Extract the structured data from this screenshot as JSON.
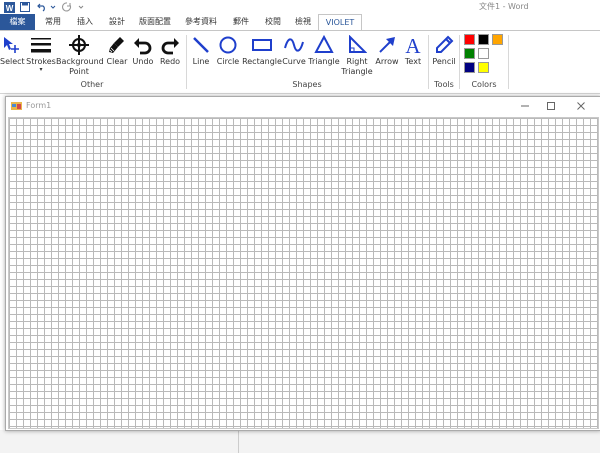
{
  "app": {
    "title": "文件1 - Word"
  },
  "tabs": [
    {
      "label": "檔案"
    },
    {
      "label": "常用"
    },
    {
      "label": "插入"
    },
    {
      "label": "設計"
    },
    {
      "label": "版面配置"
    },
    {
      "label": "參考資料"
    },
    {
      "label": "郵件"
    },
    {
      "label": "校閱"
    },
    {
      "label": "檢視"
    },
    {
      "label": "VIOLET"
    }
  ],
  "ribbon": {
    "other": {
      "group_label": "Other",
      "select": "Select",
      "strokes": "Strokes",
      "background_point": "Background Point",
      "bg_line1": "Background",
      "bg_line2": "Point",
      "clear": "Clear",
      "undo": "Undo",
      "redo": "Redo"
    },
    "shapes": {
      "group_label": "Shapes",
      "line": "Line",
      "circle": "Circle",
      "rectangle": "Rectangle",
      "curve": "Curve",
      "triangle": "Triangle",
      "right_triangle_line1": "Right",
      "right_triangle_line2": "Triangle",
      "arrow": "Arrow",
      "text": "Text"
    },
    "tools": {
      "group_label": "Tools",
      "pencil": "Pencil"
    },
    "colors": {
      "group_label": "Colors",
      "swatches": [
        "#ff0000",
        "#000000",
        "#ffa500",
        "#008000",
        "#ffffff",
        "#000080",
        "#ffff00"
      ]
    }
  },
  "form": {
    "title": "Form1"
  },
  "colors": {
    "accent": "#2b579a",
    "icon_blue": "#1f3fcc"
  }
}
